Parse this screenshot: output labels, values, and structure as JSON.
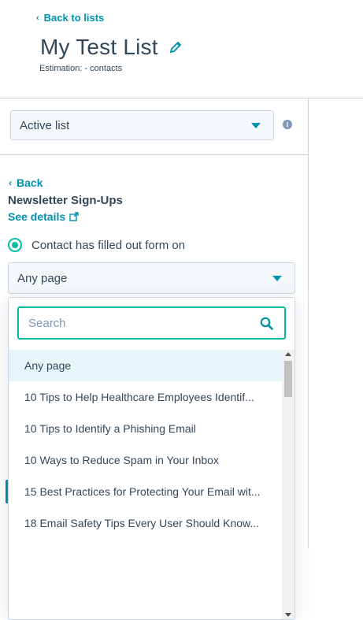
{
  "header": {
    "back_label": "Back to lists",
    "title": "My Test List",
    "estimation": "Estimation: - contacts"
  },
  "sidebar": {
    "list_type": "Active list",
    "back_label": "Back",
    "form_name": "Newsletter Sign-Ups",
    "see_details": "See details",
    "filter_option": "Contact has filled out form on",
    "page_select_value": "Any page",
    "search": {
      "placeholder": "Search",
      "value": ""
    },
    "page_options": [
      {
        "label": "Any page",
        "selected": true
      },
      {
        "label": "10 Tips to Help Healthcare Employees Identif..."
      },
      {
        "label": "10 Tips to Identify a Phishing Email"
      },
      {
        "label": "10 Ways to Reduce Spam in Your Inbox"
      },
      {
        "label": "15 Best Practices for Protecting Your Email wit..."
      },
      {
        "label": "18 Email Safety Tips Every User Should Know..."
      },
      {
        "label": ""
      },
      {
        "label": ""
      },
      {
        "label": ""
      }
    ]
  },
  "colors": {
    "accent": "#0091ae",
    "focus_teal": "#00bda5",
    "text": "#33475b",
    "border": "#cbd6e2",
    "highlight": "#e5f5f8"
  },
  "icons": {
    "back": "chevron-left-icon",
    "edit": "pencil-icon",
    "info": "info-icon",
    "external": "external-link-icon",
    "search": "search-icon"
  }
}
